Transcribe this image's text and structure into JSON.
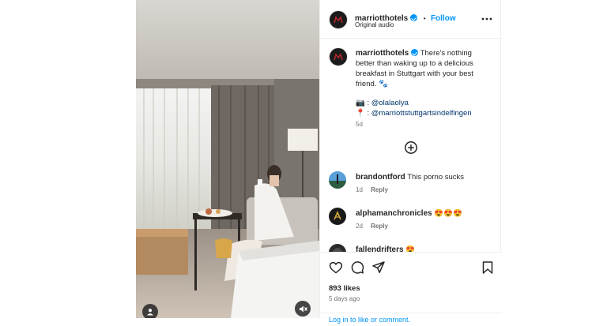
{
  "post": {
    "author": "marriotthotels",
    "follow_label": "Follow",
    "dot": "•",
    "audio": "Original audio",
    "caption": "There's nothing better than waking up to a delicious breakfast in Stuttgart with your best friend. 🐾",
    "credit_1_prefix": "📷 :",
    "credit_1": "@olalaolya",
    "credit_2_prefix": "📍 :",
    "credit_2": "@marriottstuttgartsindelfingen",
    "caption_age": "5d",
    "likes": "893 likes",
    "posted": "5 days ago",
    "login_prompt": "Log in to like or comment."
  },
  "comments": [
    {
      "user": "brandontford",
      "text": "This porno sucks",
      "age": "1d",
      "reply_label": "Reply"
    },
    {
      "user": "alphamanchronicles",
      "text": "😍😍😍",
      "age": "2d",
      "reply_label": "Reply"
    },
    {
      "user": "fallendrifters",
      "text": "😍",
      "age": "",
      "reply_label": ""
    }
  ],
  "icons": {
    "more": "more-options-icon",
    "load_more": "plus-circle-icon",
    "like": "heart-icon",
    "comment": "comment-icon",
    "share": "share-icon",
    "save": "bookmark-icon",
    "tag": "user-tag-icon",
    "mute": "muted-speaker-icon"
  },
  "colors": {
    "accent": "#0095f6",
    "brand_logo_bg": "#1b1b1b",
    "brand_logo_mark": "#b5272d"
  }
}
